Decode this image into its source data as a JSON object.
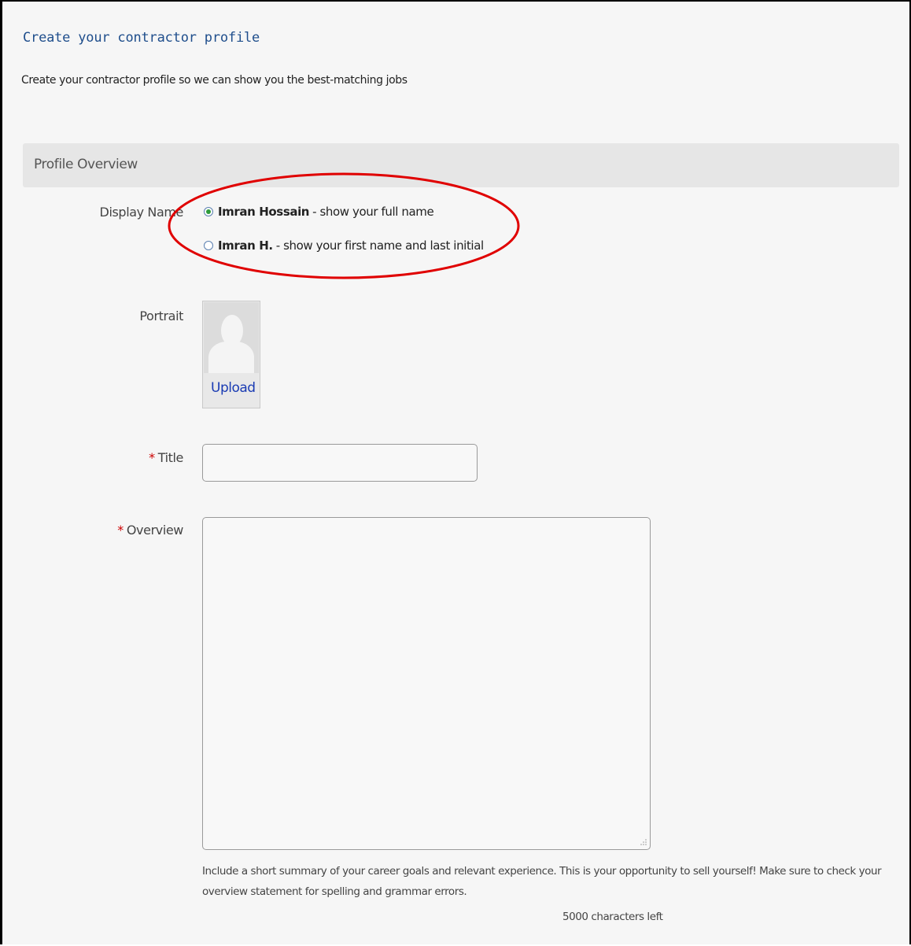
{
  "page": {
    "title": "Create your contractor profile",
    "subtitle": "Create your contractor profile so we can show you the best-matching jobs"
  },
  "section": {
    "title": "Profile Overview"
  },
  "display_name": {
    "label": "Display Name",
    "options": [
      {
        "name": "Imran Hossain",
        "description": "- show your full name",
        "selected": true
      },
      {
        "name": "Imran H.",
        "description": "- show your first name and last initial",
        "selected": false
      }
    ]
  },
  "portrait": {
    "label": "Portrait",
    "upload_label": "Upload"
  },
  "title_field": {
    "required_marker": "*",
    "label": "Title",
    "value": ""
  },
  "overview_field": {
    "required_marker": "*",
    "label": "Overview",
    "value": "",
    "help_text": "Include a short summary of your career goals and relevant experience. This is your opportunity to sell yourself! Make sure to check your overview statement for spelling and grammar errors.",
    "char_count": "5000 characters left"
  },
  "colors": {
    "title_blue": "#1f4e8c",
    "link_blue": "#1a3bb3",
    "required_red": "#cc0000",
    "annotation_red": "#e00000",
    "radio_selected_green": "#2e9b3a"
  },
  "icons": {
    "portrait_placeholder": "person-silhouette-icon",
    "resize_grip": "resize-grip-icon"
  }
}
